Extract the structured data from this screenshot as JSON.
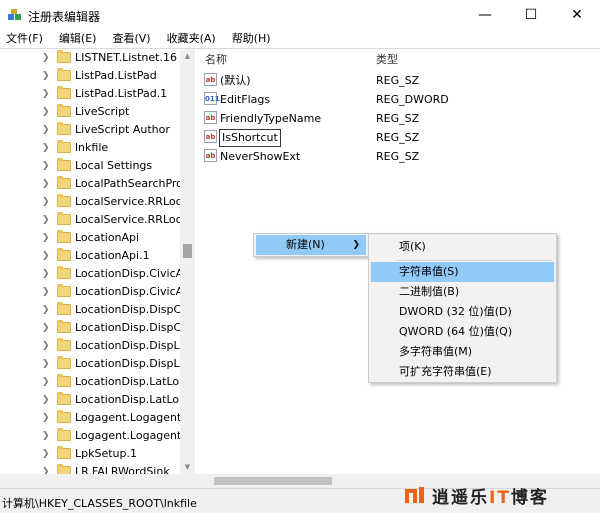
{
  "window": {
    "title": "注册表编辑器",
    "min_glyph": "—",
    "max_glyph": "☐",
    "close_glyph": "✕"
  },
  "menu": [
    "文件(F)",
    "编辑(E)",
    "查看(V)",
    "收藏夹(A)",
    "帮助(H)"
  ],
  "tree": {
    "items": [
      {
        "label": "LISTNET.Listnet.16"
      },
      {
        "label": "ListPad.ListPad"
      },
      {
        "label": "ListPad.ListPad.1"
      },
      {
        "label": "LiveScript"
      },
      {
        "label": "LiveScript Author"
      },
      {
        "label": "lnkfile",
        "selected": true
      },
      {
        "label": "Local Settings"
      },
      {
        "label": "LocalPathSearchPro"
      },
      {
        "label": "LocalService.RRLoca"
      },
      {
        "label": "LocalService.RRLoca"
      },
      {
        "label": "LocationApi"
      },
      {
        "label": "LocationApi.1"
      },
      {
        "label": "LocationDisp.CivicAc"
      },
      {
        "label": "LocationDisp.CivicAc"
      },
      {
        "label": "LocationDisp.DispCi"
      },
      {
        "label": "LocationDisp.DispCi"
      },
      {
        "label": "LocationDisp.DispLa"
      },
      {
        "label": "LocationDisp.DispLa"
      },
      {
        "label": "LocationDisp.LatLon"
      },
      {
        "label": "LocationDisp.LatLon"
      },
      {
        "label": "Logagent.Logagent"
      },
      {
        "label": "Logagent.Logagent"
      },
      {
        "label": "LpkSetup.1"
      },
      {
        "label": "LR.FALRWordSink"
      }
    ]
  },
  "list": {
    "headers": {
      "name": "名称",
      "type": "类型"
    },
    "rows": [
      {
        "name": "(默认)",
        "type": "REG_SZ",
        "icon": "string-value-icon",
        "badge": "ab"
      },
      {
        "name": "EditFlags",
        "type": "REG_DWORD",
        "icon": "binary-value-icon",
        "badge": "011"
      },
      {
        "name": "FriendlyTypeName",
        "type": "REG_SZ",
        "icon": "string-value-icon",
        "badge": "ab"
      },
      {
        "name": "IsShortcut",
        "type": "REG_SZ",
        "icon": "string-value-icon",
        "badge": "ab",
        "editing": true
      },
      {
        "name": "NeverShowExt",
        "type": "REG_SZ",
        "icon": "string-value-icon",
        "badge": "ab"
      }
    ]
  },
  "context_menu": {
    "new_label": "新建(N)",
    "submenu": [
      {
        "label": "项(K)"
      },
      {
        "label": "字符串值(S)",
        "highlight": true
      },
      {
        "label": "二进制值(B)"
      },
      {
        "label": "DWORD (32 位)值(D)"
      },
      {
        "label": "QWORD (64 位)值(Q)"
      },
      {
        "label": "多字符串值(M)"
      },
      {
        "label": "可扩充字符串值(E)"
      }
    ]
  },
  "status": {
    "path": "计算机\\HKEY_CLASSES_ROOT\\lnkfile"
  },
  "watermark": {
    "text_a": "逍遥乐",
    "text_it": "IT",
    "text_b": "博客"
  },
  "colors": {
    "highlight": "#91c9f7",
    "folder": "#f3d67c",
    "accent": "#e8641c"
  }
}
